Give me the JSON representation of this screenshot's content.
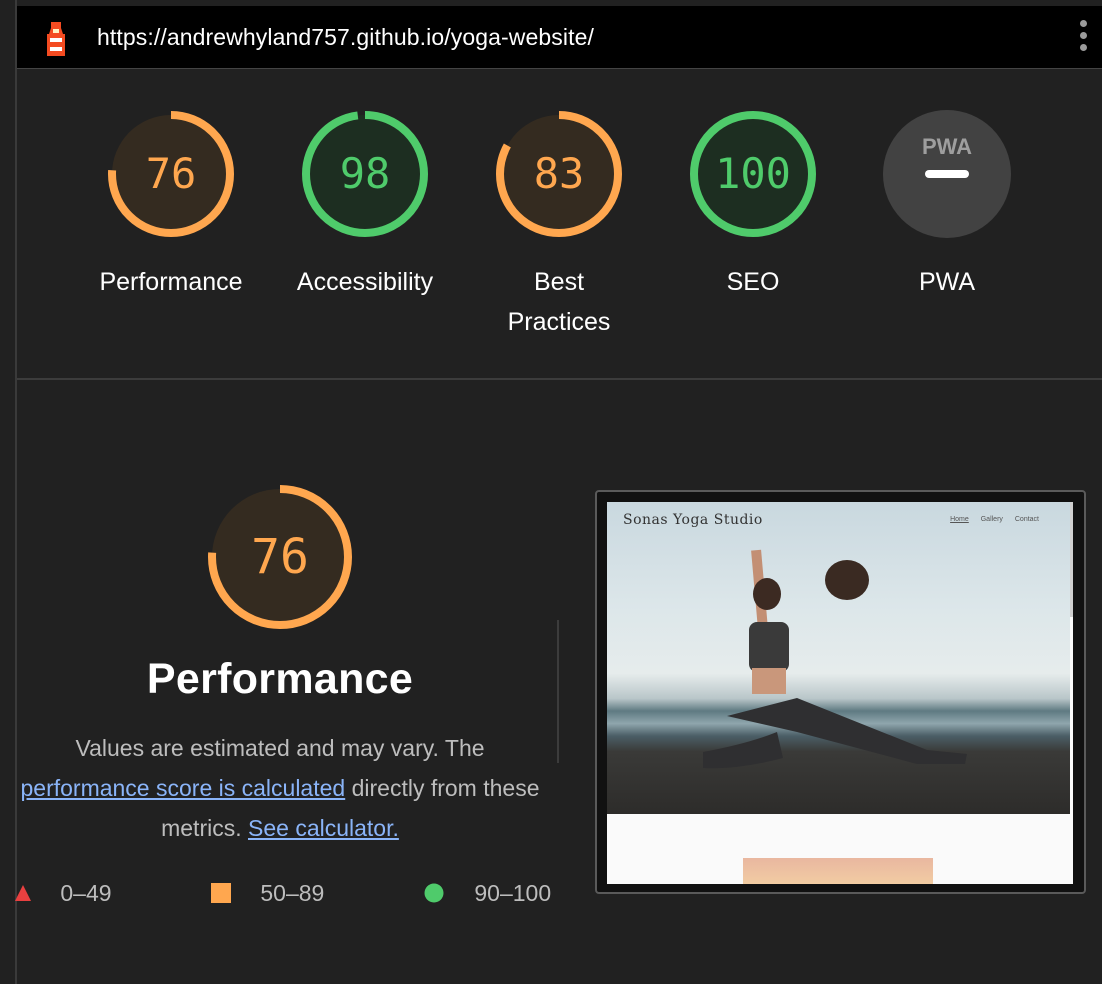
{
  "topbar": {
    "url": "https://andrewhyland757.github.io/yoga-website/",
    "logo_icon": "lighthouse-icon",
    "menu_icon": "kebab-menu-icon"
  },
  "gauges": [
    {
      "score": "76",
      "value": 76,
      "label_line1": "Performance",
      "label_line2": "",
      "color": "#ffa74f"
    },
    {
      "score": "98",
      "value": 98,
      "label_line1": "Accessibility",
      "label_line2": "",
      "color": "#4fcb6b"
    },
    {
      "score": "83",
      "value": 83,
      "label_line1": "Best",
      "label_line2": "Practices",
      "color": "#ffa74f"
    },
    {
      "score": "100",
      "value": 100,
      "label_line1": "SEO",
      "label_line2": "",
      "color": "#4fcb6b"
    }
  ],
  "pwa": {
    "badge": "PWA",
    "label": "PWA"
  },
  "performance": {
    "score": "76",
    "value": 76,
    "title": "Performance",
    "desc_part1": "Values are estimated and may vary. The",
    "link1": "performance score is calculated",
    "desc_part2": "directly from these metrics.",
    "link2": "See calculator."
  },
  "legend": [
    {
      "range": "0–49",
      "color": "#e94040"
    },
    {
      "range": "50–89",
      "color": "#ffa74f"
    },
    {
      "range": "90–100",
      "color": "#4fcb6b"
    }
  ],
  "thumbnail": {
    "brand": "Sonas Yoga Studio",
    "nav": [
      "Home",
      "Gallery",
      "Contact"
    ]
  }
}
